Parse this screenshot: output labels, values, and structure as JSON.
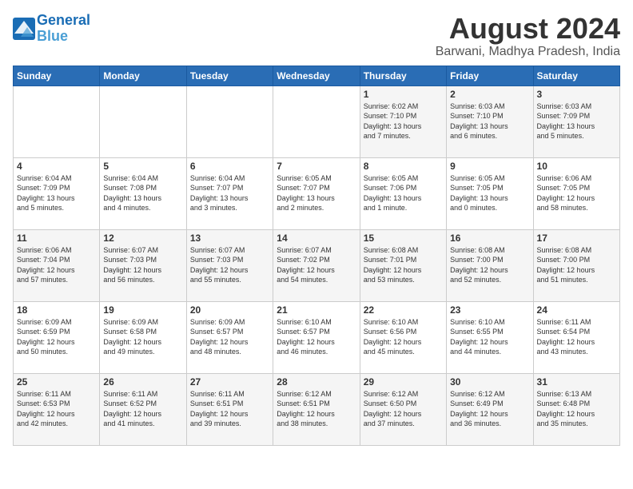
{
  "logo": {
    "line1": "General",
    "line2": "Blue"
  },
  "title": "August 2024",
  "location": "Barwani, Madhya Pradesh, India",
  "weekdays": [
    "Sunday",
    "Monday",
    "Tuesday",
    "Wednesday",
    "Thursday",
    "Friday",
    "Saturday"
  ],
  "weeks": [
    [
      {
        "day": "",
        "info": ""
      },
      {
        "day": "",
        "info": ""
      },
      {
        "day": "",
        "info": ""
      },
      {
        "day": "",
        "info": ""
      },
      {
        "day": "1",
        "info": "Sunrise: 6:02 AM\nSunset: 7:10 PM\nDaylight: 13 hours\nand 7 minutes."
      },
      {
        "day": "2",
        "info": "Sunrise: 6:03 AM\nSunset: 7:10 PM\nDaylight: 13 hours\nand 6 minutes."
      },
      {
        "day": "3",
        "info": "Sunrise: 6:03 AM\nSunset: 7:09 PM\nDaylight: 13 hours\nand 5 minutes."
      }
    ],
    [
      {
        "day": "4",
        "info": "Sunrise: 6:04 AM\nSunset: 7:09 PM\nDaylight: 13 hours\nand 5 minutes."
      },
      {
        "day": "5",
        "info": "Sunrise: 6:04 AM\nSunset: 7:08 PM\nDaylight: 13 hours\nand 4 minutes."
      },
      {
        "day": "6",
        "info": "Sunrise: 6:04 AM\nSunset: 7:07 PM\nDaylight: 13 hours\nand 3 minutes."
      },
      {
        "day": "7",
        "info": "Sunrise: 6:05 AM\nSunset: 7:07 PM\nDaylight: 13 hours\nand 2 minutes."
      },
      {
        "day": "8",
        "info": "Sunrise: 6:05 AM\nSunset: 7:06 PM\nDaylight: 13 hours\nand 1 minute."
      },
      {
        "day": "9",
        "info": "Sunrise: 6:05 AM\nSunset: 7:05 PM\nDaylight: 13 hours\nand 0 minutes."
      },
      {
        "day": "10",
        "info": "Sunrise: 6:06 AM\nSunset: 7:05 PM\nDaylight: 12 hours\nand 58 minutes."
      }
    ],
    [
      {
        "day": "11",
        "info": "Sunrise: 6:06 AM\nSunset: 7:04 PM\nDaylight: 12 hours\nand 57 minutes."
      },
      {
        "day": "12",
        "info": "Sunrise: 6:07 AM\nSunset: 7:03 PM\nDaylight: 12 hours\nand 56 minutes."
      },
      {
        "day": "13",
        "info": "Sunrise: 6:07 AM\nSunset: 7:03 PM\nDaylight: 12 hours\nand 55 minutes."
      },
      {
        "day": "14",
        "info": "Sunrise: 6:07 AM\nSunset: 7:02 PM\nDaylight: 12 hours\nand 54 minutes."
      },
      {
        "day": "15",
        "info": "Sunrise: 6:08 AM\nSunset: 7:01 PM\nDaylight: 12 hours\nand 53 minutes."
      },
      {
        "day": "16",
        "info": "Sunrise: 6:08 AM\nSunset: 7:00 PM\nDaylight: 12 hours\nand 52 minutes."
      },
      {
        "day": "17",
        "info": "Sunrise: 6:08 AM\nSunset: 7:00 PM\nDaylight: 12 hours\nand 51 minutes."
      }
    ],
    [
      {
        "day": "18",
        "info": "Sunrise: 6:09 AM\nSunset: 6:59 PM\nDaylight: 12 hours\nand 50 minutes."
      },
      {
        "day": "19",
        "info": "Sunrise: 6:09 AM\nSunset: 6:58 PM\nDaylight: 12 hours\nand 49 minutes."
      },
      {
        "day": "20",
        "info": "Sunrise: 6:09 AM\nSunset: 6:57 PM\nDaylight: 12 hours\nand 48 minutes."
      },
      {
        "day": "21",
        "info": "Sunrise: 6:10 AM\nSunset: 6:57 PM\nDaylight: 12 hours\nand 46 minutes."
      },
      {
        "day": "22",
        "info": "Sunrise: 6:10 AM\nSunset: 6:56 PM\nDaylight: 12 hours\nand 45 minutes."
      },
      {
        "day": "23",
        "info": "Sunrise: 6:10 AM\nSunset: 6:55 PM\nDaylight: 12 hours\nand 44 minutes."
      },
      {
        "day": "24",
        "info": "Sunrise: 6:11 AM\nSunset: 6:54 PM\nDaylight: 12 hours\nand 43 minutes."
      }
    ],
    [
      {
        "day": "25",
        "info": "Sunrise: 6:11 AM\nSunset: 6:53 PM\nDaylight: 12 hours\nand 42 minutes."
      },
      {
        "day": "26",
        "info": "Sunrise: 6:11 AM\nSunset: 6:52 PM\nDaylight: 12 hours\nand 41 minutes."
      },
      {
        "day": "27",
        "info": "Sunrise: 6:11 AM\nSunset: 6:51 PM\nDaylight: 12 hours\nand 39 minutes."
      },
      {
        "day": "28",
        "info": "Sunrise: 6:12 AM\nSunset: 6:51 PM\nDaylight: 12 hours\nand 38 minutes."
      },
      {
        "day": "29",
        "info": "Sunrise: 6:12 AM\nSunset: 6:50 PM\nDaylight: 12 hours\nand 37 minutes."
      },
      {
        "day": "30",
        "info": "Sunrise: 6:12 AM\nSunset: 6:49 PM\nDaylight: 12 hours\nand 36 minutes."
      },
      {
        "day": "31",
        "info": "Sunrise: 6:13 AM\nSunset: 6:48 PM\nDaylight: 12 hours\nand 35 minutes."
      }
    ]
  ]
}
